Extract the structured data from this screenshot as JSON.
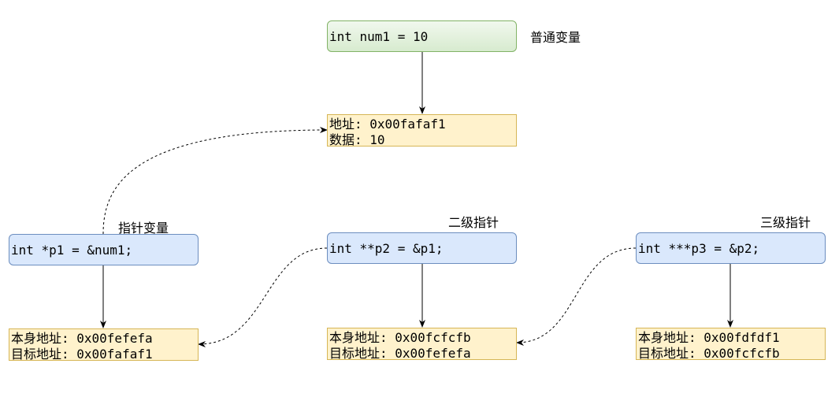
{
  "normal_var": {
    "code": "int num1 = 10",
    "caption": "普通变量",
    "memory": {
      "line1": "地址: 0x00fafaf1",
      "line2": "数据: 10"
    }
  },
  "pointer1": {
    "code": "int *p1 = &num1;",
    "caption": "指针变量",
    "memory": {
      "line1": "本身地址: 0x00fefefa",
      "line2": "目标地址: 0x00fafaf1"
    }
  },
  "pointer2": {
    "code": "int **p2 = &p1;",
    "caption": "二级指针",
    "memory": {
      "line1": "本身地址: 0x00fcfcfb",
      "line2": "目标地址: 0x00fefefa"
    }
  },
  "pointer3": {
    "code": "int ***p3 = &p2;",
    "caption": "三级指针",
    "memory": {
      "line1": "本身地址: 0x00fdfdf1",
      "line2": "目标地址: 0x00fcfcfb"
    }
  },
  "colors": {
    "var_fill": "#d5e8d4",
    "var_stroke": "#82b366",
    "ptr_fill": "#dae8fc",
    "ptr_stroke": "#6c8ebf",
    "mem_fill": "#fff2cc",
    "mem_stroke": "#d6b656"
  }
}
